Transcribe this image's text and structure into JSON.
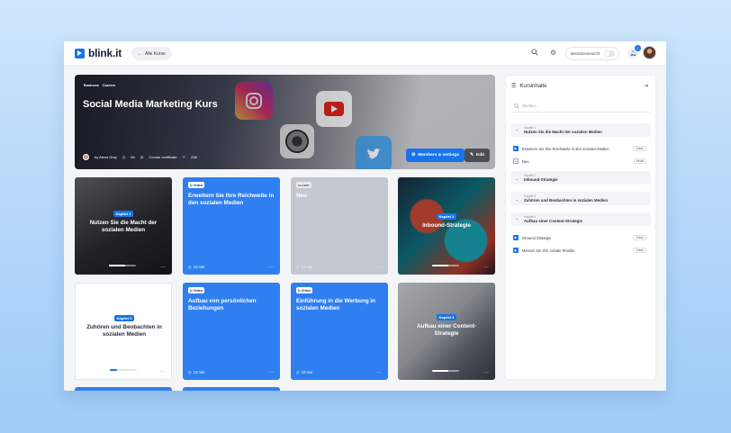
{
  "app": {
    "name": "blink.it",
    "brand_color": "#1a73e8"
  },
  "topbar": {
    "back_label": "Alle Kurse",
    "search_icon": "search-icon",
    "settings_icon": "gear-icon",
    "view_toggle_label": "Benutzeransicht",
    "notification_count": "2"
  },
  "hero": {
    "tags": [
      "Business",
      "Careers"
    ],
    "title": "Social Media Marketing Kurs",
    "author": "by Alexa Gray",
    "duration": "6h",
    "certificate": "Course certificate",
    "participants": "238",
    "members_button": "Members & settings",
    "edit_button": "Edit"
  },
  "cards": [
    {
      "chapter": "Kapitel 1",
      "title": "Nutzen Sie die Macht der sozialen Medien"
    },
    {
      "type": "Video",
      "title": "Erweitern Sie Ihre Reichweite in den sozialen Medien",
      "duration": "10 min"
    },
    {
      "type": "Leer",
      "title": "Neu",
      "duration": "10 min"
    },
    {
      "chapter": "Kapitel 2",
      "title": "Inbound-Strategie"
    },
    {
      "chapter": "Kapitel 3",
      "title": "Zuhören und Beobachten in sozialen Medien"
    },
    {
      "type": "Video",
      "title": "Aufbau von persönlichen Beziehungen",
      "duration": "10 min"
    },
    {
      "type": "Video",
      "title": "Einführung in die Werbung in sozialen Medien",
      "duration": "10 min"
    },
    {
      "chapter": "Kapitel 4",
      "title": "Aufbau einer Content-Strategie"
    }
  ],
  "sidebar": {
    "title": "Kursinhalte",
    "search_placeholder": "Suchen...",
    "sections": [
      {
        "chapter": "Kapitel 1",
        "title": "Nutzen Sie die Macht der sozialen Medien"
      },
      {
        "chapter": "Kapitel 2",
        "title": "Inbound-Strategie"
      },
      {
        "chapter": "Kapitel 3",
        "title": "Zuhören und Beobachten in sozialen Medien"
      },
      {
        "chapter": "Kapitel 4",
        "title": "Aufbau einer Content-Strategie"
      }
    ],
    "items": [
      {
        "label": "Erweitern Sie Ihre Reichweite in den sozialen Medien",
        "kind": "Video"
      },
      {
        "label": "Neu",
        "kind": "Inhalt"
      },
      {
        "label": "Inbound Strategie",
        "kind": "Video"
      },
      {
        "label": "Messen Sie Ihre soziale Rendite",
        "kind": "Video"
      }
    ]
  }
}
